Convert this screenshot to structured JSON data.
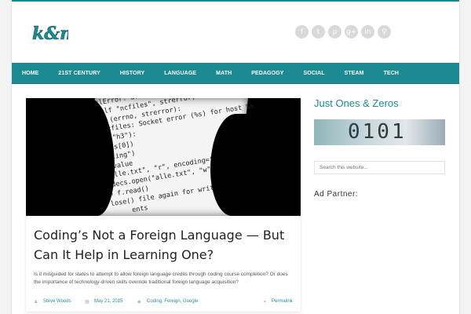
{
  "site": {
    "logo_text": "k&n"
  },
  "social_icons": [
    {
      "icon": "facebook-icon",
      "glyph": "f"
    },
    {
      "icon": "twitter-icon",
      "glyph": "t"
    },
    {
      "icon": "pinterest-icon",
      "glyph": "p"
    },
    {
      "icon": "google-plus-icon",
      "glyph": "g+"
    },
    {
      "icon": "linkedin-icon",
      "glyph": "in"
    },
    {
      "icon": "search-icon",
      "glyph": "⚲"
    }
  ],
  "nav": {
    "items": [
      "HOME",
      "21ST CENTURY",
      "HISTORY",
      "LANGUAGE",
      "MATH",
      "PEDAGOGY",
      "SOCIAL",
      "STEAM",
      "TECH"
    ]
  },
  "post": {
    "title": "Coding’s Not a Foreign Language — But Can It Help in Learning One?",
    "excerpt": "Is it misguided for states to attempt to allow foreign language credits through coding course completion? Or does the importance of technology-driven skills override traditional foreign language acquisition?",
    "author": "Steve Woods",
    "date": "May 21, 2015",
    "tags": "Coding, Foreign, Google",
    "permalink": "Permalink"
  },
  "sidebar": {
    "title": "Just Ones & Zeros",
    "image_text": "0101",
    "search_placeholder": "Search this website...",
    "ad_title": "Ad Partner:"
  },
  "colors": {
    "accent": "#1c8a92",
    "link": "#2a8aa3"
  }
}
